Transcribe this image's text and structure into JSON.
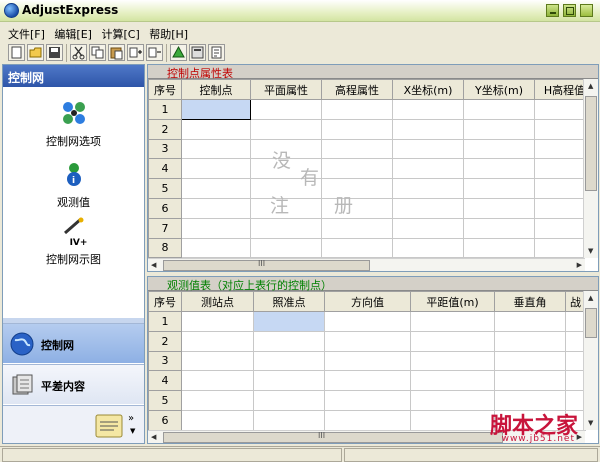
{
  "app": {
    "title": "AdjustExpress"
  },
  "menu": [
    "文件[F]",
    "编辑[E]",
    "计算[C]",
    "帮助[H]"
  ],
  "left_panel": {
    "header": "控制网",
    "items": [
      {
        "label": "控制网选项",
        "icon": "network-options-icon"
      },
      {
        "label": "观测值",
        "icon": "observation-icon"
      },
      {
        "label": "控制网示图",
        "icon": "network-diagram-icon",
        "badge": "IV+"
      }
    ],
    "nav": [
      {
        "label": "控制网",
        "icon": "globe-icon",
        "active": true
      },
      {
        "label": "平差内容",
        "icon": "server-icon",
        "active": false
      }
    ],
    "bottom_more": "»"
  },
  "control_points": {
    "title": "控制点属性表",
    "columns": [
      "序号",
      "控制点",
      "平面属性",
      "高程属性",
      "X坐标(m)",
      "Y坐标(m)",
      "H高程值"
    ],
    "rows": [
      "1",
      "2",
      "3",
      "4",
      "5",
      "6",
      "7",
      "8"
    ],
    "hscroll_label": "III"
  },
  "observations": {
    "title": "观测值表（对应上表行的控制点）",
    "columns": [
      "序号",
      "测站点",
      "照准点",
      "方向值",
      "平距值(m)",
      "垂直角",
      "战"
    ],
    "rows": [
      "1",
      "2",
      "3",
      "4",
      "5",
      "6"
    ],
    "hscroll_label": "III"
  },
  "watermark": [
    "没",
    "有",
    "注",
    "册"
  ],
  "brand": {
    "text": "脚本之家",
    "url": "www.jb51.net"
  },
  "colors": {
    "header_blue": "#2e55a8",
    "selected_cell": "#c6d8f3",
    "title_red": "#c00000",
    "title_green": "#008000"
  }
}
